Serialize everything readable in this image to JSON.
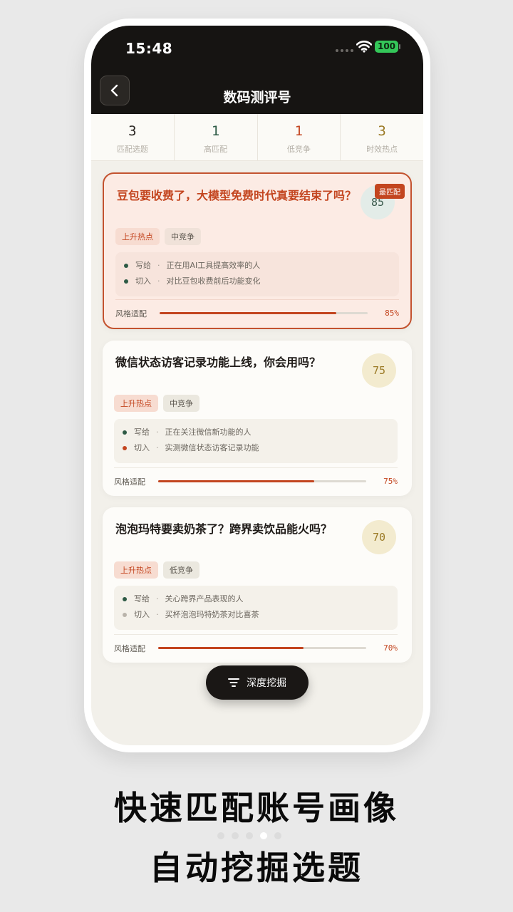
{
  "status_bar": {
    "time": "15:48",
    "battery": "100"
  },
  "nav": {
    "title": "数码测评号"
  },
  "stats": [
    {
      "value": "3",
      "label": "匹配选题",
      "color": "#2a2622"
    },
    {
      "value": "1",
      "label": "高匹配",
      "color": "#2d5a45"
    },
    {
      "value": "1",
      "label": "低竞争",
      "color": "#c3451f"
    },
    {
      "value": "3",
      "label": "时效热点",
      "color": "#9b7a26"
    }
  ],
  "cards": [
    {
      "title": "豆包要收费了，大模型免费时代真要结束了吗？",
      "badge": "最匹配",
      "score": "85",
      "tags": [
        "上升热点",
        "中竞争"
      ],
      "notes": [
        {
          "key": "写给",
          "sep": "·",
          "text": "正在用AI工具提高效率的人"
        },
        {
          "key": "切入",
          "sep": "·",
          "text": "对比豆包收费前后功能变化"
        }
      ],
      "fit_label": "风格适配",
      "fit_value": 0.85,
      "fit_pct": "85%"
    },
    {
      "title": "微信状态访客记录功能上线，你会用吗？",
      "score": "75",
      "tags": [
        "上升热点",
        "中竞争"
      ],
      "notes": [
        {
          "key": "写给",
          "sep": "·",
          "text": "正在关注微信新功能的人"
        },
        {
          "key": "切入",
          "sep": "·",
          "text": "实测微信状态访客记录功能"
        }
      ],
      "fit_label": "风格适配",
      "fit_value": 0.75,
      "fit_pct": "75%"
    },
    {
      "title": "泡泡玛特要卖奶茶了？跨界卖饮品能火吗？",
      "score": "70",
      "tags": [
        "上升热点",
        "低竞争"
      ],
      "notes": [
        {
          "key": "写给",
          "sep": "·",
          "text": "关心跨界产品表现的人"
        },
        {
          "key": "切入",
          "sep": "·",
          "text": "买杯泡泡玛特奶茶对比喜茶"
        }
      ],
      "fit_label": "风格适配",
      "fit_value": 0.7,
      "fit_pct": "70%"
    }
  ],
  "fab": {
    "label": "深度挖掘"
  },
  "promo": {
    "line1": "快速匹配账号画像",
    "line2": "自动挖掘选题"
  },
  "pager": {
    "count": 5,
    "active": 3
  }
}
